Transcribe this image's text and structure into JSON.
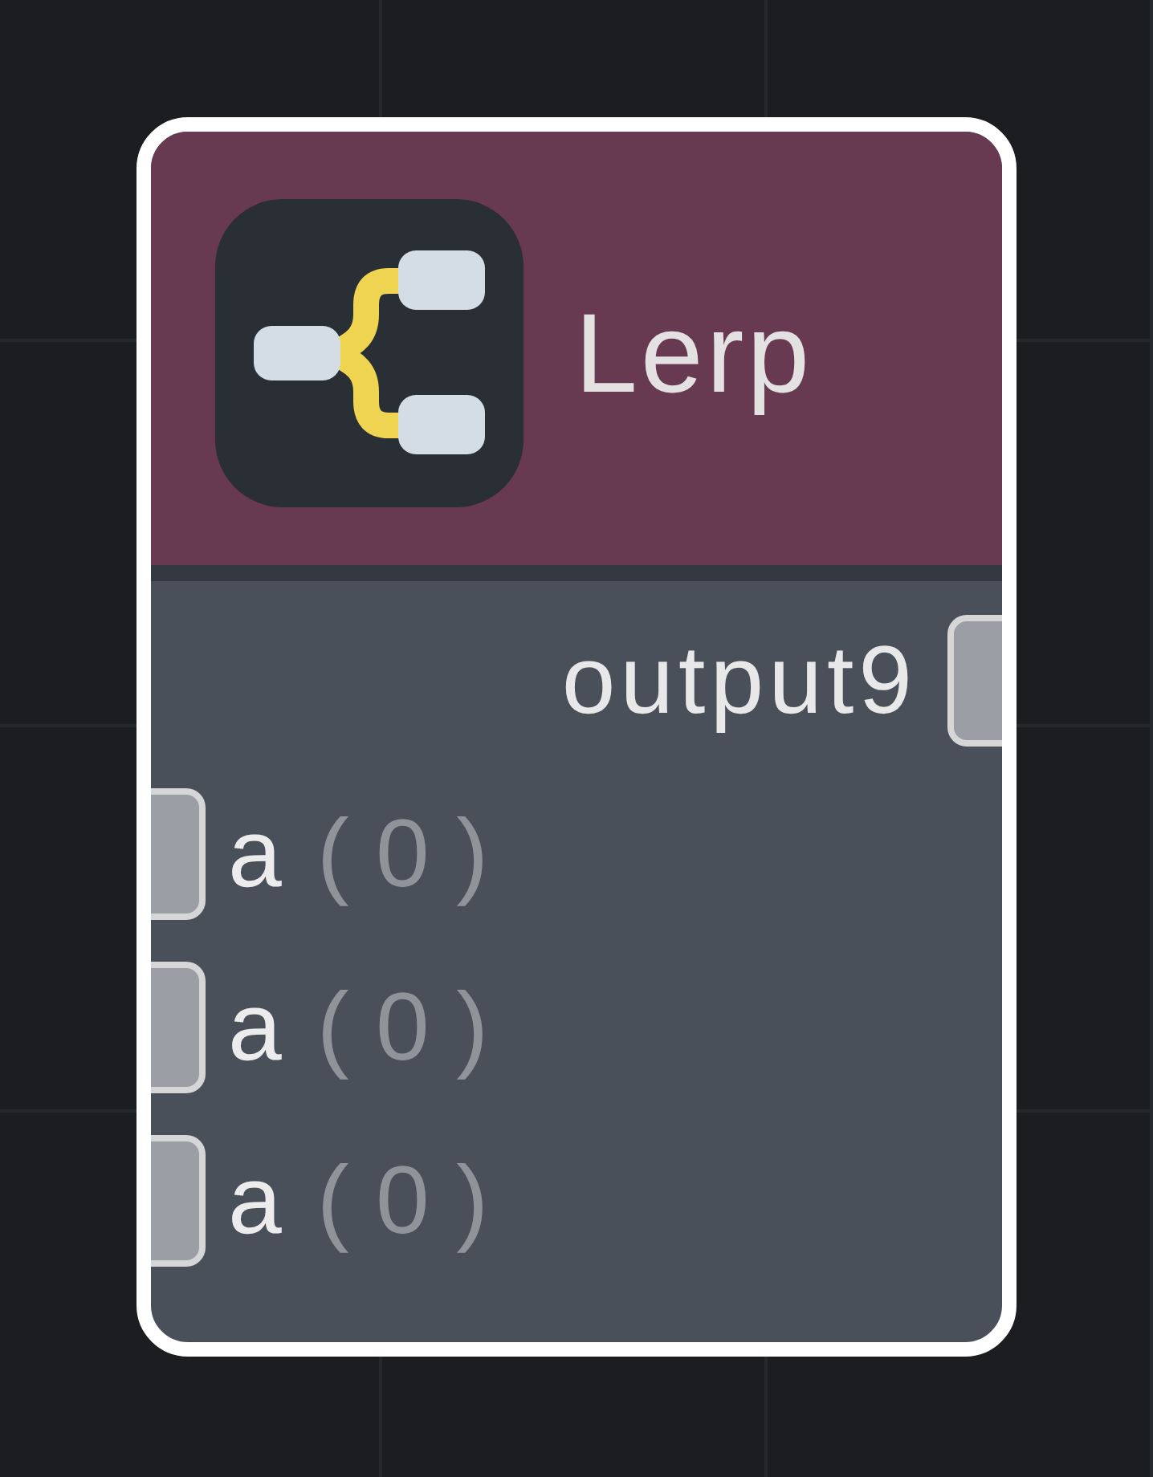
{
  "node": {
    "title": "Lerp",
    "outputs": [
      {
        "label": "output9"
      }
    ],
    "inputs": [
      {
        "label": "a",
        "value": "( 0 )"
      },
      {
        "label": "a",
        "value": "( 0 )"
      },
      {
        "label": "a",
        "value": "( 0 )"
      }
    ]
  }
}
